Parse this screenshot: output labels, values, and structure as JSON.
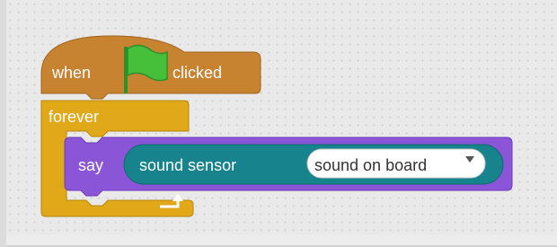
{
  "hat_block": {
    "label_before": "when",
    "label_after": "clicked",
    "icon": "green-flag-icon",
    "color": "#c88330"
  },
  "control_block": {
    "label": "forever",
    "icon": "loop-arrow-icon",
    "color": "#e1a91a"
  },
  "looks_block": {
    "label": "say",
    "color": "#8a55d7"
  },
  "reporter_block": {
    "label": "sound sensor",
    "color": "#17848d"
  },
  "dropdown": {
    "value": "sound on board",
    "icon": "dropdown-arrow-icon"
  }
}
